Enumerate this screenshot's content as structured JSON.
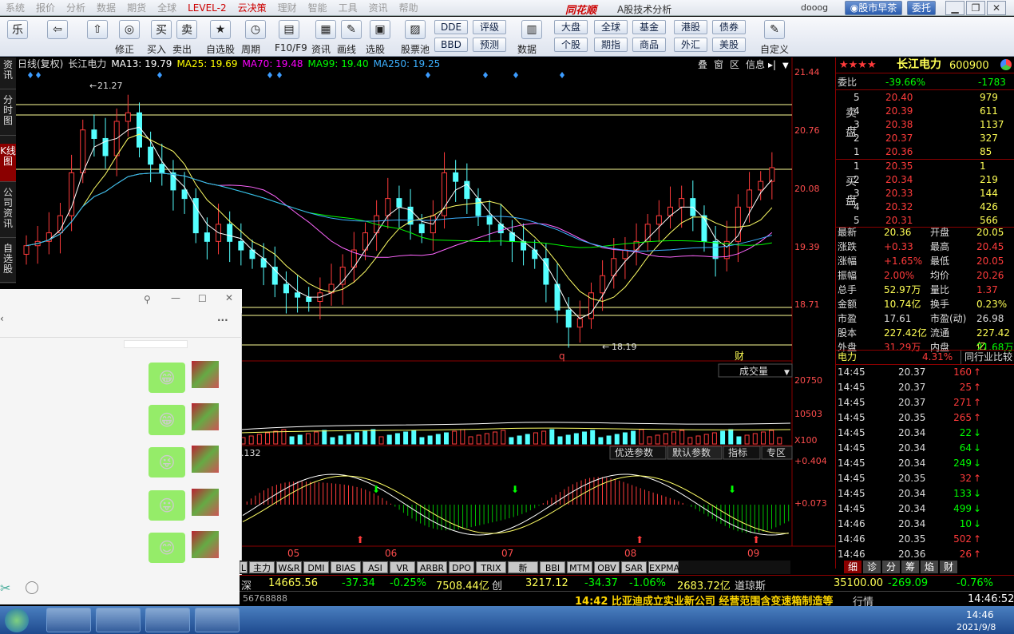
{
  "menu": [
    "系统",
    "报价",
    "分析",
    "数据",
    "期货",
    "全球",
    "LEVEL-2",
    "云决策",
    "理财",
    "智能",
    "工具",
    "资讯",
    "帮助"
  ],
  "menu_red": [
    "LEVEL-2",
    "云决策"
  ],
  "brand": "同花顺",
  "product": "A股技术分析",
  "username": "dooog",
  "btn_morning": "股市早茶",
  "btn_trust": "委托",
  "toolbar": {
    "items": [
      "修正",
      "买入",
      "卖出",
      "自选股",
      "周期",
      "F10/F9",
      "资讯",
      "画线",
      "选股",
      "股票池",
      "数据",
      "自定义"
    ],
    "small": [
      "DDE",
      "BBD",
      "评级",
      "预测",
      "大盘",
      "个股",
      "全球",
      "期指",
      "基金",
      "商品",
      "港股",
      "外汇",
      "债券",
      "美股"
    ]
  },
  "lefttabs": [
    "资讯",
    "分时图",
    "K线图",
    "公司资讯",
    "自选股"
  ],
  "chart": {
    "header_title": "日线(复权)",
    "stock_label": "长江电力",
    "ma": [
      {
        "name": "MA13: 19.79",
        "color": "#ffffff"
      },
      {
        "name": "MA25: 19.69",
        "color": "#ffff00"
      },
      {
        "name": "MA70: 19.48",
        "color": "#ff00ff"
      },
      {
        "name": "MA99: 19.40",
        "color": "#00ff00"
      },
      {
        "name": "MA250: 19.25",
        "color": "#3cb0ff"
      }
    ],
    "top_buttons": [
      "叠",
      "窗",
      "区",
      "信息"
    ],
    "price_axis": [
      "21.44",
      "20.76",
      "20.08",
      "19.39",
      "18.71"
    ],
    "high_label": "21.27",
    "low_label": "18.19",
    "mark_q": "q",
    "mark_cai": "财",
    "volume_selector": "成交量",
    "volume_axis": [
      "20750",
      "10503",
      "X100"
    ],
    "macd_value": ".132",
    "macd_tabs": [
      "优选参数",
      "默认参数",
      "指标",
      "专区"
    ],
    "macd_axis": [
      "+0.404",
      "+0.073"
    ],
    "months": [
      "05",
      "06",
      "07",
      "08",
      "09"
    ]
  },
  "chart_data": {
    "type": "candlestick",
    "title": "日线(复权) 长江电力",
    "y_range": [
      18.19,
      21.44
    ],
    "high": 21.27,
    "low": 18.19,
    "close_series": [
      19.45,
      19.5,
      19.6,
      19.8,
      20.3,
      20.8,
      20.7,
      20.5,
      20.9,
      21.0,
      20.6,
      20.4,
      20.3,
      20.1,
      20.0,
      19.6,
      19.5,
      19.7,
      19.5,
      19.4,
      19.3,
      19.2,
      19.0,
      18.9,
      18.85,
      18.8,
      18.9,
      19.0,
      19.2,
      19.4,
      19.6,
      19.8,
      20.0,
      19.9,
      19.7,
      19.6,
      19.8,
      20.3,
      20.2,
      20.0,
      19.8,
      19.7,
      19.6,
      19.5,
      19.4,
      19.3,
      19.0,
      18.7,
      18.5,
      18.6,
      18.9,
      19.1,
      19.3,
      19.4,
      19.5,
      19.7,
      19.8,
      19.9,
      20.0,
      19.8,
      19.5,
      19.3,
      19.5,
      19.9,
      20.1,
      20.2,
      20.36
    ]
  },
  "order_book": {
    "name": "长江电力",
    "code": "600900",
    "weibi": "-39.66%",
    "weicha": "-1783",
    "sell": [
      [
        "5",
        "20.40",
        "979"
      ],
      [
        "4",
        "20.39",
        "611"
      ],
      [
        "3",
        "20.38",
        "1137"
      ],
      [
        "2",
        "20.37",
        "327"
      ],
      [
        "1",
        "20.36",
        "85"
      ]
    ],
    "buy": [
      [
        "1",
        "20.35",
        "1"
      ],
      [
        "2",
        "20.34",
        "219"
      ],
      [
        "3",
        "20.33",
        "144"
      ],
      [
        "4",
        "20.32",
        "426"
      ],
      [
        "5",
        "20.31",
        "566"
      ]
    ],
    "stats": [
      [
        "最新",
        "20.36",
        "开盘",
        "20.05"
      ],
      [
        "涨跌",
        "+0.33",
        "最高",
        "20.45"
      ],
      [
        "涨幅",
        "+1.65%",
        "最低",
        "20.05"
      ],
      [
        "振幅",
        "2.00%",
        "均价",
        "20.26"
      ],
      [
        "总手",
        "52.97万",
        "量比",
        "1.37"
      ],
      [
        "金额",
        "10.74亿",
        "换手",
        "0.23%"
      ],
      [
        "市盈",
        "17.61",
        "市盈(动)",
        "26.98"
      ],
      [
        "股本",
        "227.42亿",
        "流通",
        "227.42亿"
      ],
      [
        "外盘",
        "31.29万",
        "内盘",
        "21.68万"
      ]
    ],
    "industry_label": "电力",
    "industry_pct": "4.31%",
    "industry_btn": "同行业比较",
    "ticks": [
      [
        "14:45",
        "20.37",
        "160",
        "up"
      ],
      [
        "14:45",
        "20.37",
        "25",
        "up"
      ],
      [
        "14:45",
        "20.37",
        "271",
        "up"
      ],
      [
        "14:45",
        "20.35",
        "265",
        "up"
      ],
      [
        "14:45",
        "20.34",
        "22",
        "down"
      ],
      [
        "14:45",
        "20.34",
        "64",
        "down"
      ],
      [
        "14:45",
        "20.34",
        "249",
        "down"
      ],
      [
        "14:45",
        "20.35",
        "32",
        "up"
      ],
      [
        "14:45",
        "20.34",
        "133",
        "down"
      ],
      [
        "14:45",
        "20.34",
        "499",
        "down"
      ],
      [
        "14:46",
        "20.34",
        "10",
        "down"
      ],
      [
        "14:46",
        "20.35",
        "502",
        "up"
      ],
      [
        "14:46",
        "20.36",
        "26",
        "up"
      ]
    ],
    "bottom_tabs": [
      "细",
      "诊",
      "分",
      "筹",
      "焰",
      "财"
    ]
  },
  "index_tabs": [
    "L",
    "主力",
    "W&R",
    "DMI",
    "BIAS",
    "ASI",
    "VR",
    "ARBR",
    "DPO",
    "TRIX",
    "新DMA",
    "BBI",
    "MTM",
    "OBV",
    "SAR",
    "EXPMA"
  ],
  "ticker": {
    "name1": "深",
    "v1": "14665.56",
    "c1": "-37.34",
    "p1": "-0.25%",
    "amt1": "7508.44亿",
    "name2": "创",
    "v2": "3217.12",
    "c2": "-34.37",
    "p2": "-1.06%",
    "amt2": "2683.72亿",
    "name3": "道琼斯",
    "v3": "35100.00",
    "c3": "-269.09",
    "p3": "-0.76%"
  },
  "status": {
    "phone": "56768888",
    "news": "14:42 比亚迪成立实业新公司 经营范围含变速箱制造等",
    "quote": "行情",
    "time": "14:46:52"
  },
  "taskbar": {
    "time": "14:46",
    "date": "2021/9/8"
  }
}
